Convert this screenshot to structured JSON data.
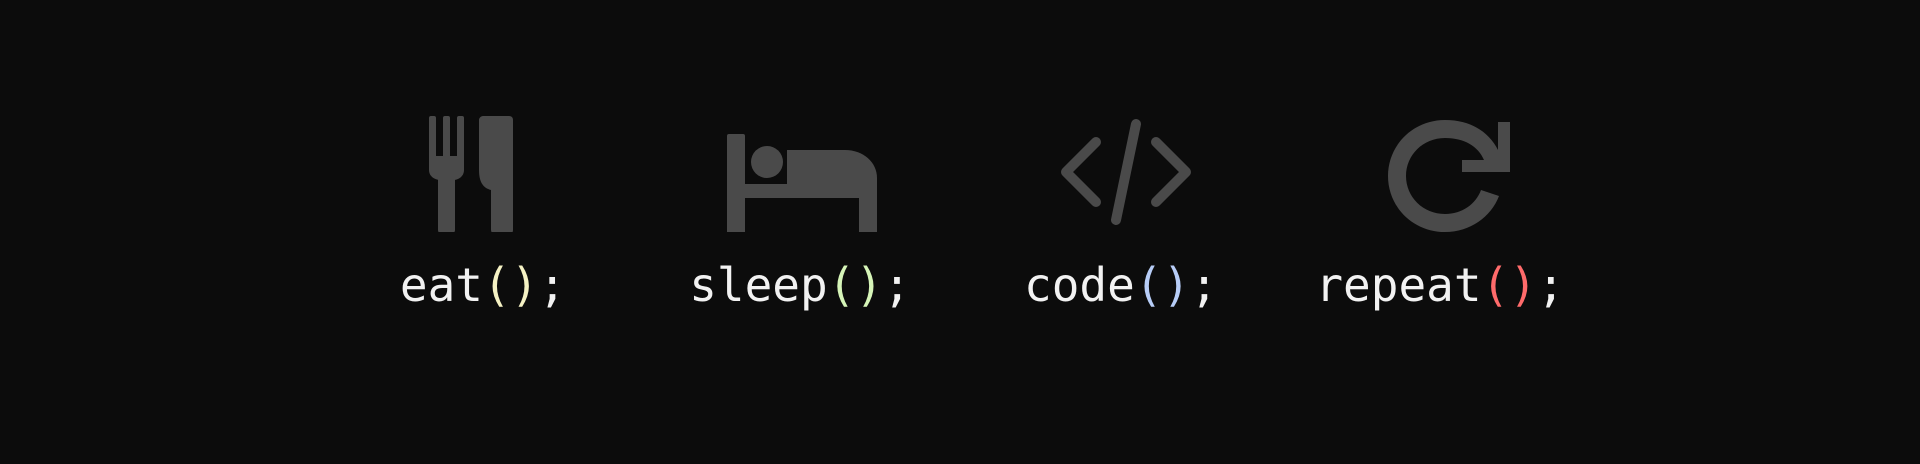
{
  "colors": {
    "background": "#0c0c0c",
    "icon": "#4a4a4a",
    "text": "#f2f2f2"
  },
  "items": [
    {
      "icon": "fork-knife-icon",
      "name": "eat",
      "open": "(",
      "close": ")",
      "end": ";",
      "paren_color": "#f5f2c4"
    },
    {
      "icon": "bed-icon",
      "name": "sleep",
      "open": "(",
      "close": ")",
      "end": ";",
      "paren_color": "#d6f5b8"
    },
    {
      "icon": "code-icon",
      "name": "code",
      "open": "(",
      "close": ")",
      "end": ";",
      "paren_color": "#b7cdf7"
    },
    {
      "icon": "refresh-icon",
      "name": "repeat",
      "open": "(",
      "close": ")",
      "end": ";",
      "paren_color": "#ff6b6b"
    }
  ]
}
